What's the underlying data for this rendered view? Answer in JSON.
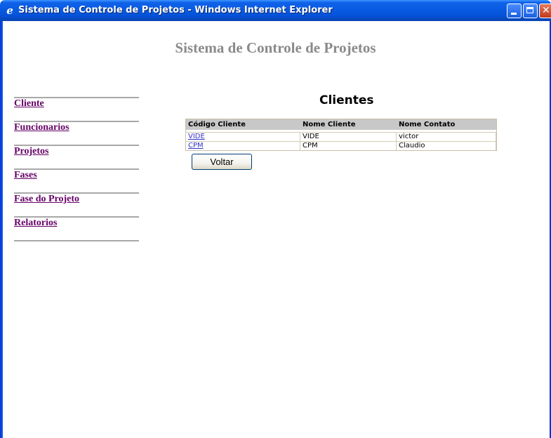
{
  "window": {
    "title": "Sistema de Controle de Projetos - Windows Internet Explorer",
    "icon": "ie-icon"
  },
  "page": {
    "title": "Sistema de Controle de Projetos",
    "section_title": "Clientes",
    "back_button": "Voltar"
  },
  "menu": {
    "items": [
      {
        "label": "Cliente"
      },
      {
        "label": "Funcionarios"
      },
      {
        "label": "Projetos"
      },
      {
        "label": "Fases"
      },
      {
        "label": "Fase do Projeto"
      },
      {
        "label": "Relatorios"
      }
    ]
  },
  "table": {
    "headers": [
      "Código Cliente",
      "Nome Cliente",
      "Nome Contato"
    ],
    "rows": [
      [
        "VIDE",
        "VIDE",
        "victor"
      ],
      [
        "CPM",
        "CPM",
        "Claudio"
      ]
    ]
  },
  "colors": {
    "title_gray": "#8a8a8a",
    "menu_link": "#660066",
    "table_link": "#3333cc",
    "header_bg": "#c8c8c8"
  }
}
